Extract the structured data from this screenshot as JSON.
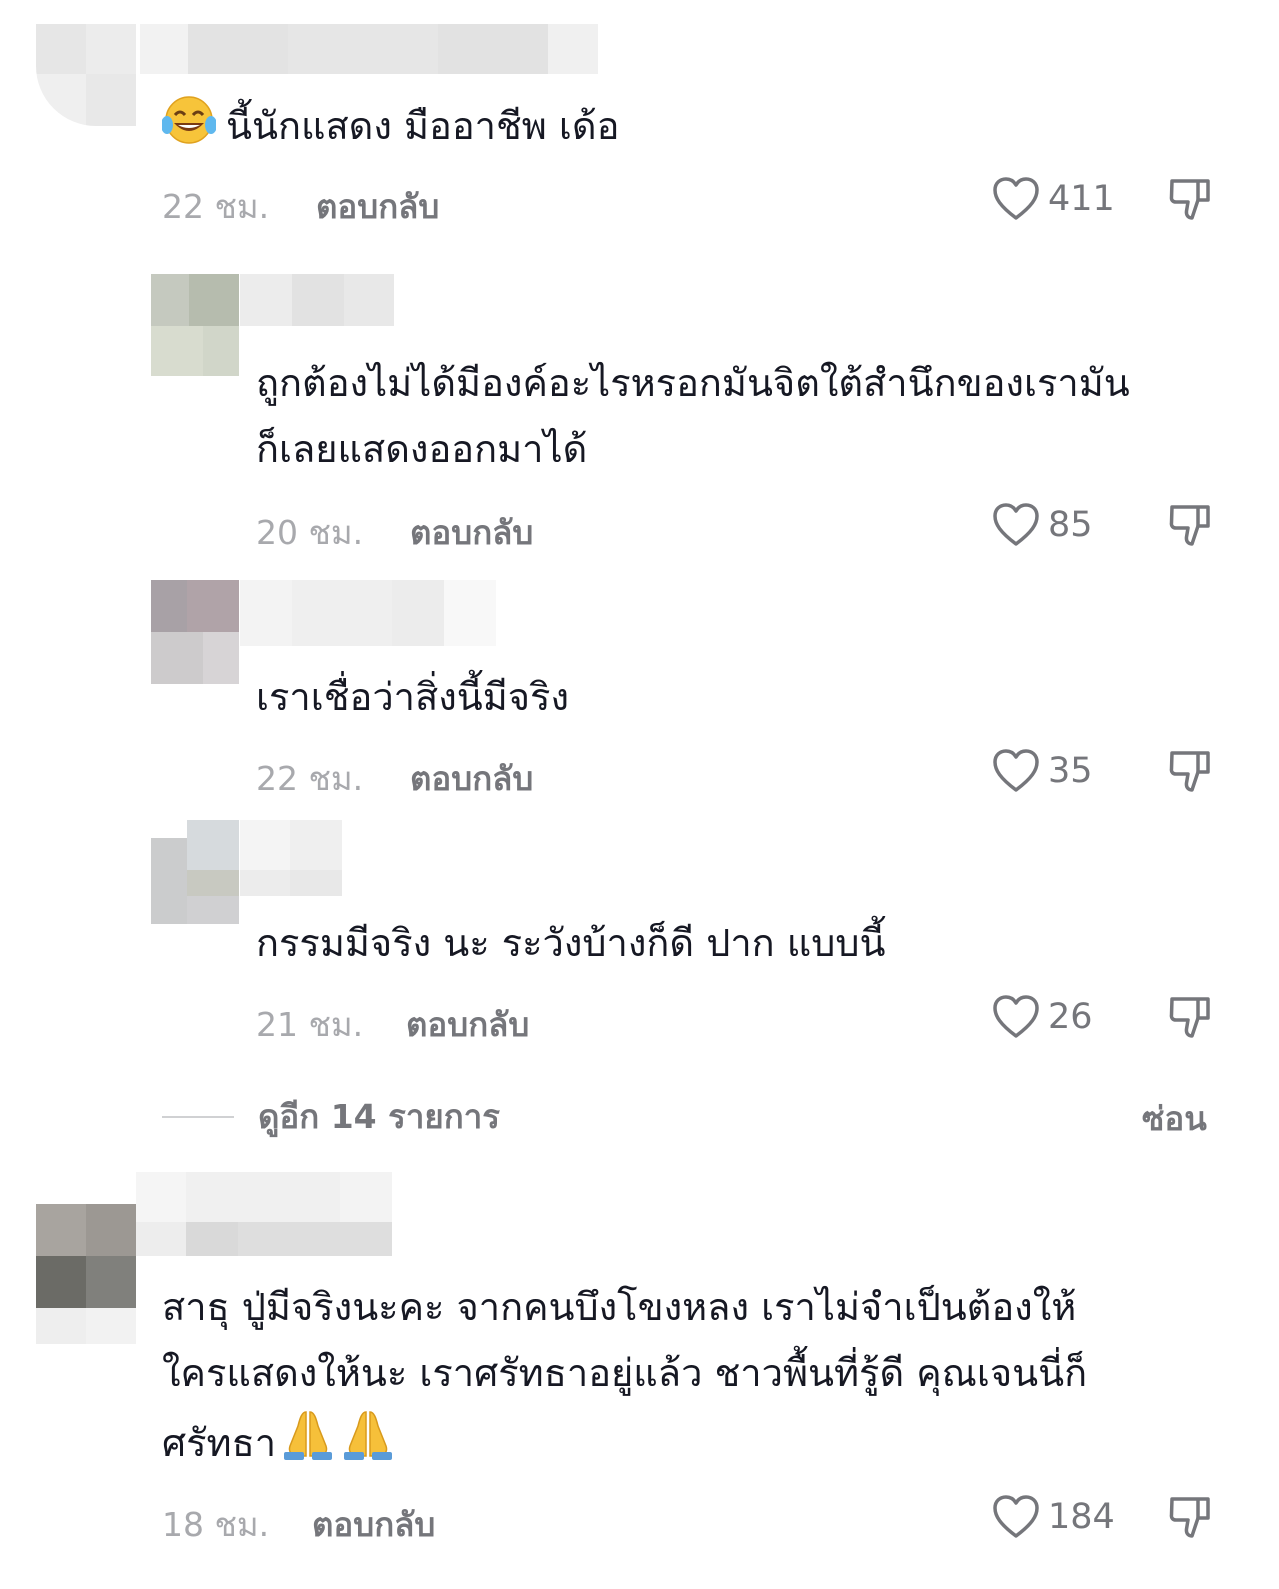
{
  "comments": [
    {
      "text_lines": [
        "นี้นักแสดง มืออาชีพ เด้อ"
      ],
      "emoji_prefix": "laughing-tears-emoji",
      "time": "22 ชม.",
      "reply_label": "ตอบกลับ",
      "likes": "411"
    },
    {
      "text_lines": [
        "ถูกต้องไม่ได้มีองค์อะไรหรอกมันจิตใต้สำนึกของเรามัน",
        "ก็เลยแสดงออกมาได้"
      ],
      "time": "20 ชม.",
      "reply_label": "ตอบกลับ",
      "likes": "85"
    },
    {
      "text_lines": [
        "เราเชื่อว่าสิ่งนี้มีจริง"
      ],
      "time": "22 ชม.",
      "reply_label": "ตอบกลับ",
      "likes": "35"
    },
    {
      "text_lines": [
        "กรรมมีจริง นะ ระวังบ้างก็ดี ปาก แบบนี้"
      ],
      "time": "21 ชม.",
      "reply_label": "ตอบกลับ",
      "likes": "26"
    },
    {
      "text_lines": [
        "สาธุ ปู่มีจริงนะคะ จากคนบึงโขงหลง เราไม่จำเป็นต้องให้",
        "ใครแสดงให้นะ เราศรัทธาอยู่แล้ว ชาวพื้นที่รู้ดี คุณเจนนี่ก็",
        "ศรัทธา"
      ],
      "emoji_suffix": "folded-hands-emoji x2",
      "time": "18 ชม.",
      "reply_label": "ตอบกลับ",
      "likes": "184"
    }
  ],
  "view_more": {
    "label": "ดูอีก 14 รายการ",
    "hide_label": "ซ่อน"
  },
  "colors": {
    "text": "#161823",
    "meta": "#a8a9ad",
    "action": "#75767b"
  }
}
